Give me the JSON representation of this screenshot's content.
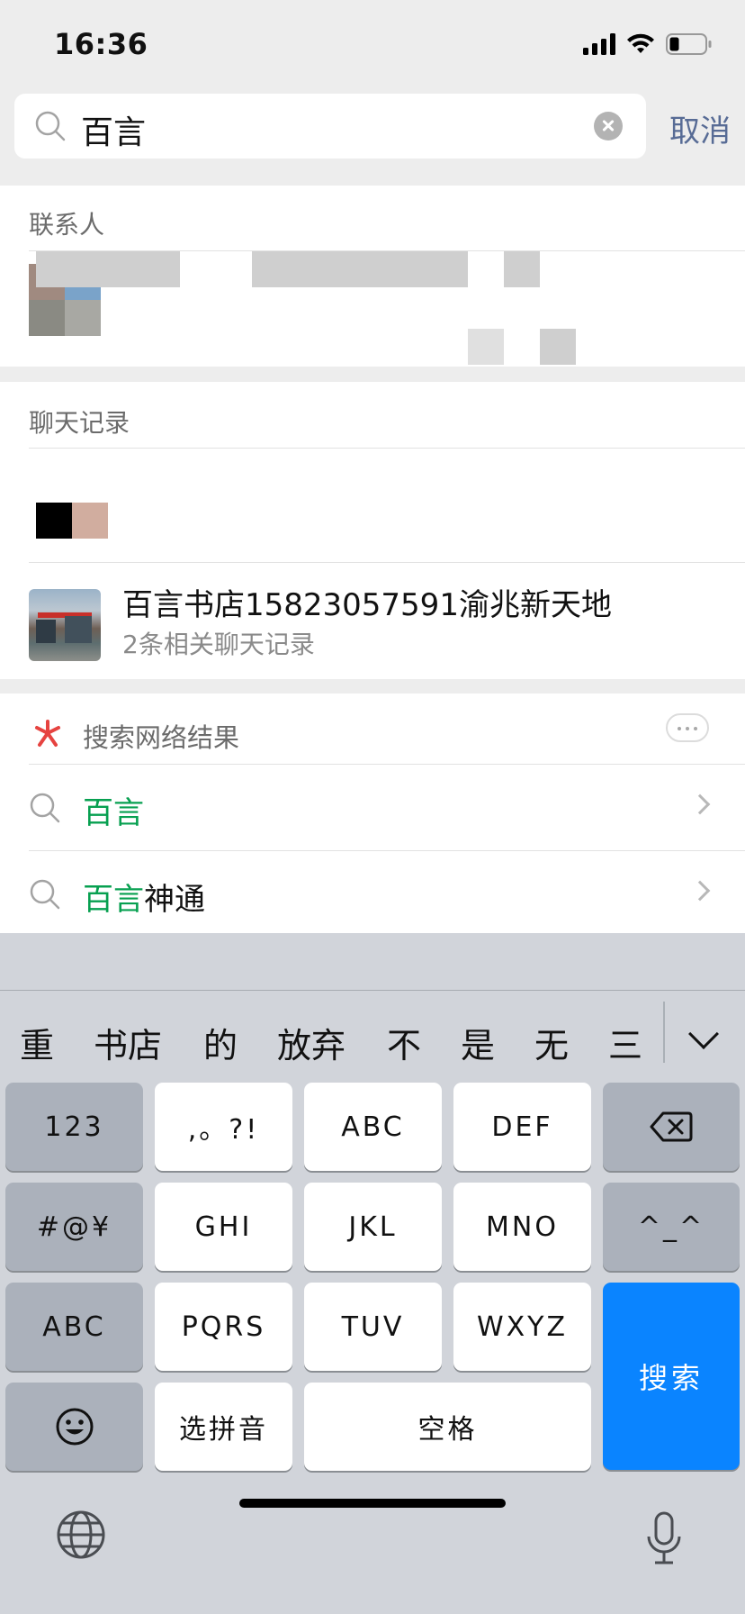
{
  "status_bar": {
    "time": "16:36"
  },
  "search": {
    "query": "百言",
    "cancel_label": "取消"
  },
  "contacts_section": {
    "title": "联系人"
  },
  "chat_section": {
    "title": "聊天记录",
    "results": [
      {
        "title": "百言书店15823057591渝兆新天地",
        "subtitle": "2条相关聊天记录"
      }
    ]
  },
  "web_section": {
    "title": "搜索网络结果",
    "suggestions": [
      {
        "highlight": "百言",
        "rest": ""
      },
      {
        "highlight": "百言",
        "rest": "神通"
      }
    ]
  },
  "keyboard": {
    "candidates": [
      "重",
      "书店",
      "的",
      "放弃",
      "不",
      "是",
      "无",
      "三"
    ],
    "keys": {
      "num": "123",
      "punct": ",。?!",
      "abc1": "ABC",
      "def": "DEF",
      "sym": "#@¥",
      "ghi": "GHI",
      "jkl": "JKL",
      "mno": "MNO",
      "face": "^_^",
      "abc2": "ABC",
      "pqrs": "PQRS",
      "tuv": "TUV",
      "wxyz": "WXYZ",
      "search": "搜索",
      "pinyin": "选拼音",
      "space": "空格"
    }
  },
  "colors": {
    "accent_link": "#576b95",
    "highlight_green": "#07a050",
    "keyboard_blue": "#0a84ff"
  }
}
